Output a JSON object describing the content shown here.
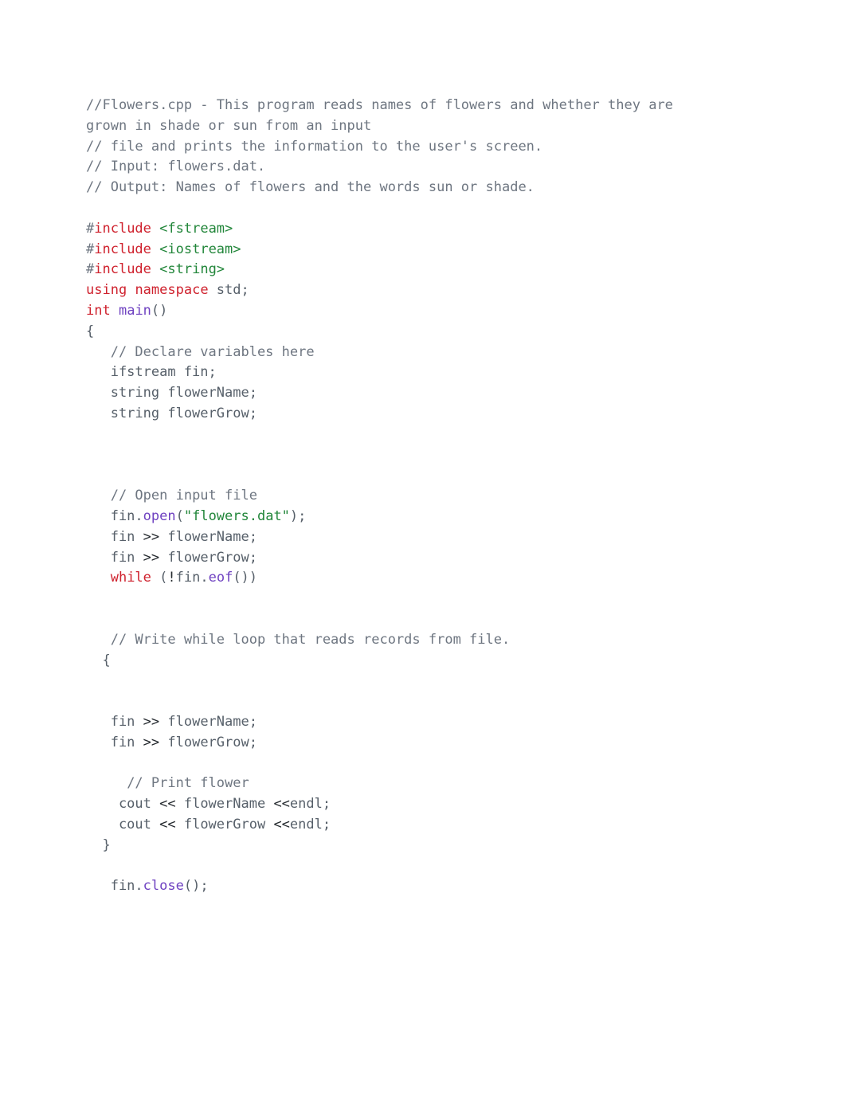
{
  "code": {
    "lines": [
      {
        "tokens": [
          {
            "cls": "comment",
            "text": "//Flowers.cpp - This program reads names of flowers and whether they are"
          }
        ]
      },
      {
        "tokens": [
          {
            "cls": "comment",
            "text": "grown in shade or sun from an input"
          }
        ]
      },
      {
        "tokens": [
          {
            "cls": "comment",
            "text": "// file and prints the information to the user's screen."
          }
        ]
      },
      {
        "tokens": [
          {
            "cls": "comment",
            "text": "// Input: flowers.dat."
          }
        ]
      },
      {
        "tokens": [
          {
            "cls": "comment",
            "text": "// Output: Names of flowers and the words sun or shade."
          }
        ]
      },
      {
        "tokens": []
      },
      {
        "tokens": [
          {
            "cls": "hash",
            "text": "#"
          },
          {
            "cls": "keyword",
            "text": "include"
          },
          {
            "cls": "ident",
            "text": " "
          },
          {
            "cls": "string",
            "text": "<fstream>"
          }
        ]
      },
      {
        "tokens": [
          {
            "cls": "hash",
            "text": "#"
          },
          {
            "cls": "keyword",
            "text": "include"
          },
          {
            "cls": "ident",
            "text": " "
          },
          {
            "cls": "string",
            "text": "<iostream>"
          }
        ]
      },
      {
        "tokens": [
          {
            "cls": "hash",
            "text": "#"
          },
          {
            "cls": "keyword",
            "text": "include"
          },
          {
            "cls": "ident",
            "text": " "
          },
          {
            "cls": "string",
            "text": "<string>"
          }
        ]
      },
      {
        "tokens": [
          {
            "cls": "keyword",
            "text": "using"
          },
          {
            "cls": "ident",
            "text": " "
          },
          {
            "cls": "keyword",
            "text": "namespace"
          },
          {
            "cls": "ident",
            "text": " std;"
          }
        ]
      },
      {
        "tokens": [
          {
            "cls": "type",
            "text": "int"
          },
          {
            "cls": "ident",
            "text": " "
          },
          {
            "cls": "funcname",
            "text": "main"
          },
          {
            "cls": "punc",
            "text": "()"
          }
        ]
      },
      {
        "tokens": [
          {
            "cls": "punc",
            "text": "{"
          }
        ]
      },
      {
        "tokens": [
          {
            "cls": "ident",
            "text": "   "
          },
          {
            "cls": "comment",
            "text": "// Declare variables here"
          }
        ]
      },
      {
        "tokens": [
          {
            "cls": "ident",
            "text": "   ifstream fin;"
          }
        ]
      },
      {
        "tokens": [
          {
            "cls": "ident",
            "text": "   string flowerName;"
          }
        ]
      },
      {
        "tokens": [
          {
            "cls": "ident",
            "text": "   string flowerGrow;"
          }
        ]
      },
      {
        "tokens": []
      },
      {
        "tokens": []
      },
      {
        "tokens": []
      },
      {
        "tokens": [
          {
            "cls": "ident",
            "text": "   "
          },
          {
            "cls": "comment",
            "text": "// Open input file"
          }
        ]
      },
      {
        "tokens": [
          {
            "cls": "ident",
            "text": "   fin."
          },
          {
            "cls": "method",
            "text": "open"
          },
          {
            "cls": "punc",
            "text": "("
          },
          {
            "cls": "string",
            "text": "\"flowers.dat\""
          },
          {
            "cls": "punc",
            "text": ");"
          }
        ]
      },
      {
        "tokens": [
          {
            "cls": "ident",
            "text": "   fin "
          },
          {
            "cls": "op",
            "text": ">>"
          },
          {
            "cls": "ident",
            "text": " flowerName;"
          }
        ]
      },
      {
        "tokens": [
          {
            "cls": "ident",
            "text": "   fin "
          },
          {
            "cls": "op",
            "text": ">>"
          },
          {
            "cls": "ident",
            "text": " flowerGrow;"
          }
        ]
      },
      {
        "tokens": [
          {
            "cls": "ident",
            "text": "   "
          },
          {
            "cls": "keyword",
            "text": "while"
          },
          {
            "cls": "ident",
            "text": " ("
          },
          {
            "cls": "op",
            "text": "!"
          },
          {
            "cls": "ident",
            "text": "fin."
          },
          {
            "cls": "method",
            "text": "eof"
          },
          {
            "cls": "punc",
            "text": "())"
          }
        ]
      },
      {
        "tokens": []
      },
      {
        "tokens": []
      },
      {
        "tokens": [
          {
            "cls": "ident",
            "text": "   "
          },
          {
            "cls": "comment",
            "text": "// Write while loop that reads records from file."
          }
        ]
      },
      {
        "tokens": [
          {
            "cls": "ident",
            "text": "  {"
          }
        ]
      },
      {
        "tokens": []
      },
      {
        "tokens": []
      },
      {
        "tokens": [
          {
            "cls": "ident",
            "text": "   fin "
          },
          {
            "cls": "op",
            "text": ">>"
          },
          {
            "cls": "ident",
            "text": " flowerName;"
          }
        ]
      },
      {
        "tokens": [
          {
            "cls": "ident",
            "text": "   fin "
          },
          {
            "cls": "op",
            "text": ">>"
          },
          {
            "cls": "ident",
            "text": " flowerGrow;"
          }
        ]
      },
      {
        "tokens": []
      },
      {
        "tokens": [
          {
            "cls": "ident",
            "text": "     "
          },
          {
            "cls": "comment",
            "text": "// Print flower"
          }
        ]
      },
      {
        "tokens": [
          {
            "cls": "ident",
            "text": "    cout "
          },
          {
            "cls": "op",
            "text": "<<"
          },
          {
            "cls": "ident",
            "text": " flowerName "
          },
          {
            "cls": "op",
            "text": "<<"
          },
          {
            "cls": "ident",
            "text": "endl;"
          }
        ]
      },
      {
        "tokens": [
          {
            "cls": "ident",
            "text": "    cout "
          },
          {
            "cls": "op",
            "text": "<<"
          },
          {
            "cls": "ident",
            "text": " flowerGrow "
          },
          {
            "cls": "op",
            "text": "<<"
          },
          {
            "cls": "ident",
            "text": "endl;"
          }
        ]
      },
      {
        "tokens": [
          {
            "cls": "ident",
            "text": "  }"
          }
        ]
      },
      {
        "tokens": []
      },
      {
        "tokens": [
          {
            "cls": "ident",
            "text": "   fin."
          },
          {
            "cls": "method",
            "text": "close"
          },
          {
            "cls": "punc",
            "text": "();"
          }
        ]
      }
    ]
  }
}
